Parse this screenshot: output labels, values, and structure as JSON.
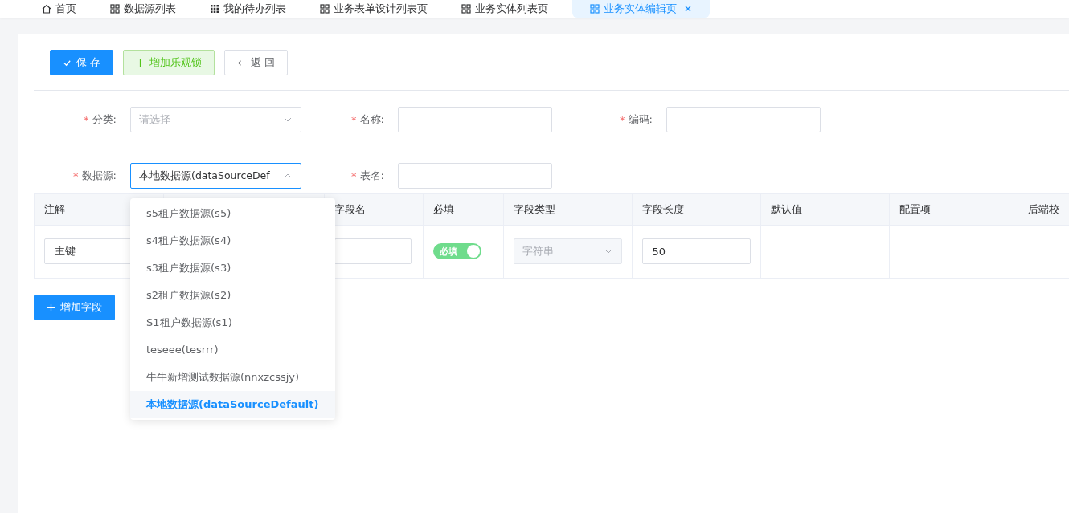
{
  "tabs": [
    {
      "label": "首页",
      "kind": "home",
      "selected": false
    },
    {
      "label": "数据源列表",
      "kind": "grid",
      "selected": false
    },
    {
      "label": "我的待办列表",
      "kind": "dots",
      "selected": false
    },
    {
      "label": "业务表单设计列表页",
      "kind": "grid",
      "selected": false
    },
    {
      "label": "业务实体列表页",
      "kind": "grid",
      "selected": false
    },
    {
      "label": "业务实体编辑页",
      "kind": "grid",
      "selected": true
    }
  ],
  "toolbar": [
    {
      "label": "保 存",
      "kind": "primary"
    },
    {
      "label": "增加乐观锁",
      "kind": "success"
    },
    {
      "label": "返 回",
      "kind": "plain"
    }
  ],
  "form_rows": [
    [
      {
        "label": "分类:",
        "mark": "*",
        "kind": "select",
        "placeholder": "请选择",
        "open": false
      },
      {
        "label": "名称:",
        "mark": "*",
        "kind": "input"
      },
      {
        "label": "编码:",
        "mark": "*",
        "kind": "input"
      }
    ],
    [
      {
        "label": "数据源:",
        "mark": "*",
        "kind": "select",
        "value": "本地数据源(dataSourceDef",
        "open": true
      },
      {
        "label": "表名:",
        "mark": "*",
        "kind": "input"
      }
    ]
  ],
  "datasource_options": [
    {
      "label": "s5租户数据源(s5)",
      "selected": false
    },
    {
      "label": "s4租户数据源(s4)",
      "selected": false
    },
    {
      "label": "s3租户数据源(s3)",
      "selected": false
    },
    {
      "label": "s2租户数据源(s2)",
      "selected": false
    },
    {
      "label": "S1租户数据源(s1)",
      "selected": false
    },
    {
      "label": "teseee(tesrrr)",
      "selected": false
    },
    {
      "label": "牛牛新增测试数据源(nnxzcssjy)",
      "selected": false
    },
    {
      "label": "本地数据源(dataSourceDefault)",
      "selected": true
    }
  ],
  "table": {
    "columns": [
      "注解",
      "",
      "字段名",
      "必填",
      "字段类型",
      "字段长度",
      "默认值",
      "配置项",
      "后端校"
    ],
    "rows": [
      [
        {
          "kind": "input",
          "value": "主键"
        },
        {
          "kind": "empty"
        },
        {
          "kind": "input"
        },
        {
          "kind": "switch",
          "label": "必填",
          "on": true
        },
        {
          "kind": "select",
          "value": "字符串",
          "disabled": true
        },
        {
          "kind": "input",
          "value": "50"
        },
        {
          "kind": "empty"
        },
        {
          "kind": "empty"
        },
        {
          "kind": "empty"
        }
      ]
    ]
  },
  "add_field_button": "增加字段"
}
